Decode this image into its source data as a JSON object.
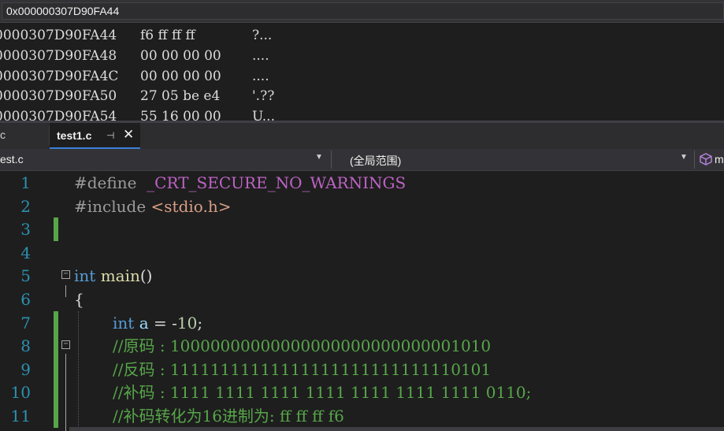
{
  "memory": {
    "address_input": "0x000000307D90FA44",
    "rows": [
      {
        "addr": "0000307D90FA44",
        "bytes": "f6 ff ff ff",
        "ascii": "?..."
      },
      {
        "addr": "0000307D90FA48",
        "bytes": "00 00 00 00",
        "ascii": "...."
      },
      {
        "addr": "0000307D90FA4C",
        "bytes": "00 00 00 00",
        "ascii": "...."
      },
      {
        "addr": "0000307D90FA50",
        "bytes": "27 05 be e4",
        "ascii": "'.??"
      },
      {
        "addr": "0000307D90FA54",
        "bytes": "55 16 00 00",
        "ascii": "U..."
      }
    ]
  },
  "tabs": {
    "previous_label": "c",
    "active_label": "test1.c"
  },
  "nav": {
    "file": "est.c",
    "scope": "(全局范围)",
    "member": "m"
  },
  "code": {
    "line_numbers": [
      "1",
      "2",
      "3",
      "4",
      "5",
      "6",
      "7",
      "8",
      "9",
      "10",
      "11"
    ],
    "l1_directive": "#define",
    "l1_macro": "_CRT_SECURE_NO_WARNINGS",
    "l2_directive": "#include",
    "l2_header": "<stdio.h>",
    "l5_type": "int",
    "l5_func": "main",
    "l5_parens": "()",
    "l6_brace": "{",
    "l7_type": "int",
    "l7_var": "a",
    "l7_op": " = -",
    "l7_num": "10",
    "l7_end": ";",
    "l8_comment": "//原码 : 10000000000000000000000000001010",
    "l9_comment": "//反码 : 11111111111111111111111111110101",
    "l10_comment": "//补码 : 1111 1111 1111 1111 1111 1111 1111 0110;",
    "l11_comment": "//补码转化为16进制为: ff ff ff f6"
  },
  "colors": {
    "keyword": "#569cd6",
    "comment": "#57a64a",
    "macro": "#bd63c5",
    "line_number": "#2b91af",
    "tab_accent": "#3b7ed8"
  }
}
